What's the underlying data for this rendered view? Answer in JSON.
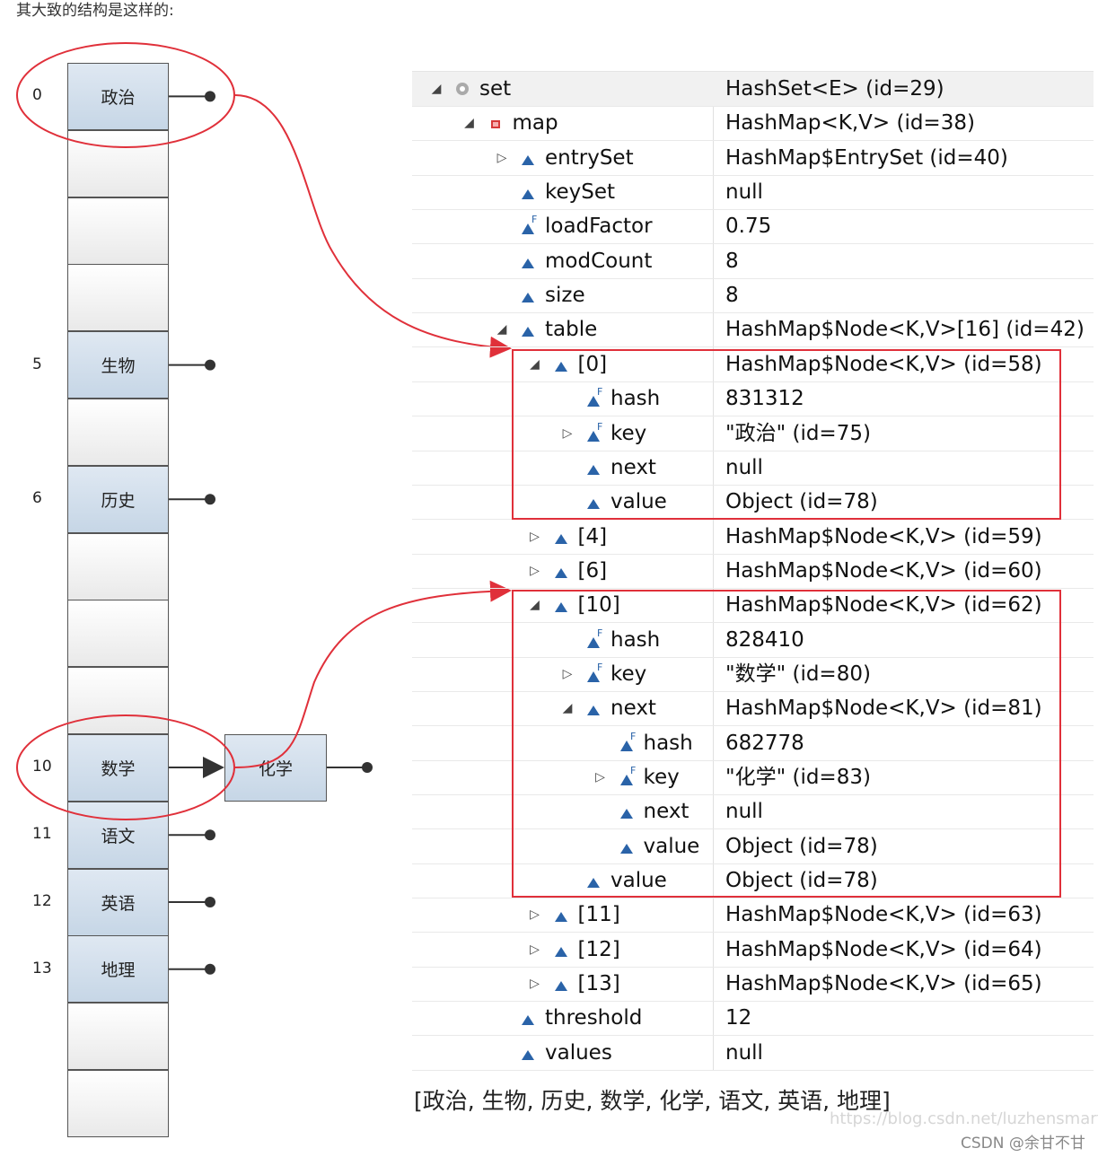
{
  "intro": "其大致的结构是这样的:",
  "buckets": [
    {
      "index": "0",
      "label": "政治"
    },
    {
      "index": "",
      "label": ""
    },
    {
      "index": "",
      "label": ""
    },
    {
      "index": "",
      "label": ""
    },
    {
      "index": "5",
      "label": "生物"
    },
    {
      "index": "",
      "label": ""
    },
    {
      "index": "6",
      "label": "历史"
    },
    {
      "index": "",
      "label": ""
    },
    {
      "index": "",
      "label": ""
    },
    {
      "index": "",
      "label": ""
    },
    {
      "index": "10",
      "label": "数学"
    },
    {
      "index": "11",
      "label": "语文"
    },
    {
      "index": "12",
      "label": "英语"
    },
    {
      "index": "13",
      "label": "地理"
    },
    {
      "index": "",
      "label": ""
    },
    {
      "index": "",
      "label": ""
    }
  ],
  "chain_node": "化学",
  "tree": [
    {
      "exp": "expanded",
      "icon": "private-icon",
      "name": "set",
      "value": "HashSet<E>  (id=29)"
    },
    {
      "exp": "expanded",
      "icon": "private-field-icon",
      "name": "map",
      "value": "HashMap<K,V>  (id=38)"
    },
    {
      "exp": "collapsed",
      "icon": "field-icon",
      "name": "entrySet",
      "value": "HashMap$EntrySet  (id=40)"
    },
    {
      "exp": "",
      "icon": "field-icon",
      "name": "keySet",
      "value": "null"
    },
    {
      "exp": "",
      "icon": "final-field-icon",
      "name": "loadFactor",
      "value": "0.75"
    },
    {
      "exp": "",
      "icon": "field-icon",
      "name": "modCount",
      "value": "8"
    },
    {
      "exp": "",
      "icon": "field-icon",
      "name": "size",
      "value": "8"
    },
    {
      "exp": "expanded",
      "icon": "field-icon",
      "name": "table",
      "value": "HashMap$Node<K,V>[16]  (id=42)"
    },
    {
      "exp": "expanded",
      "icon": "field-icon",
      "name": "[0]",
      "value": "HashMap$Node<K,V>  (id=58)"
    },
    {
      "exp": "",
      "icon": "final-field-icon",
      "name": "hash",
      "value": "831312"
    },
    {
      "exp": "collapsed",
      "icon": "final-field-icon",
      "name": "key",
      "value": "\"政治\" (id=75)"
    },
    {
      "exp": "",
      "icon": "field-icon",
      "name": "next",
      "value": "null"
    },
    {
      "exp": "",
      "icon": "field-icon",
      "name": "value",
      "value": "Object  (id=78)"
    },
    {
      "exp": "collapsed",
      "icon": "field-icon",
      "name": "[4]",
      "value": "HashMap$Node<K,V>  (id=59)"
    },
    {
      "exp": "collapsed",
      "icon": "field-icon",
      "name": "[6]",
      "value": "HashMap$Node<K,V>  (id=60)"
    },
    {
      "exp": "expanded",
      "icon": "field-icon",
      "name": "[10]",
      "value": "HashMap$Node<K,V>  (id=62)"
    },
    {
      "exp": "",
      "icon": "final-field-icon",
      "name": "hash",
      "value": "828410"
    },
    {
      "exp": "collapsed",
      "icon": "final-field-icon",
      "name": "key",
      "value": "\"数学\" (id=80)"
    },
    {
      "exp": "expanded",
      "icon": "field-icon",
      "name": "next",
      "value": "HashMap$Node<K,V>  (id=81)"
    },
    {
      "exp": "",
      "icon": "final-field-icon",
      "name": "hash",
      "value": "682778"
    },
    {
      "exp": "collapsed",
      "icon": "final-field-icon",
      "name": "key",
      "value": "\"化学\" (id=83)"
    },
    {
      "exp": "",
      "icon": "field-icon",
      "name": "next",
      "value": "null"
    },
    {
      "exp": "",
      "icon": "field-icon",
      "name": "value",
      "value": "Object  (id=78)"
    },
    {
      "exp": "",
      "icon": "field-icon",
      "name": "value",
      "value": "Object  (id=78)"
    },
    {
      "exp": "collapsed",
      "icon": "field-icon",
      "name": "[11]",
      "value": "HashMap$Node<K,V>  (id=63)"
    },
    {
      "exp": "collapsed",
      "icon": "field-icon",
      "name": "[12]",
      "value": "HashMap$Node<K,V>  (id=64)"
    },
    {
      "exp": "collapsed",
      "icon": "field-icon",
      "name": "[13]",
      "value": "HashMap$Node<K,V>  (id=65)"
    },
    {
      "exp": "",
      "icon": "field-icon",
      "name": "threshold",
      "value": "12"
    },
    {
      "exp": "",
      "icon": "field-icon",
      "name": "values",
      "value": "null"
    }
  ],
  "result": "[政治, 生物, 历史, 数学, 化学, 语文, 英语, 地理]",
  "watermark_url": "https://blog.csdn.net/luzhensmart",
  "watermark_author": "CSDN @余甘不甘",
  "colors": {
    "highlight": "#e0303a",
    "node_fill": "#c6d6e6",
    "field_icon": "#2a63a8"
  }
}
